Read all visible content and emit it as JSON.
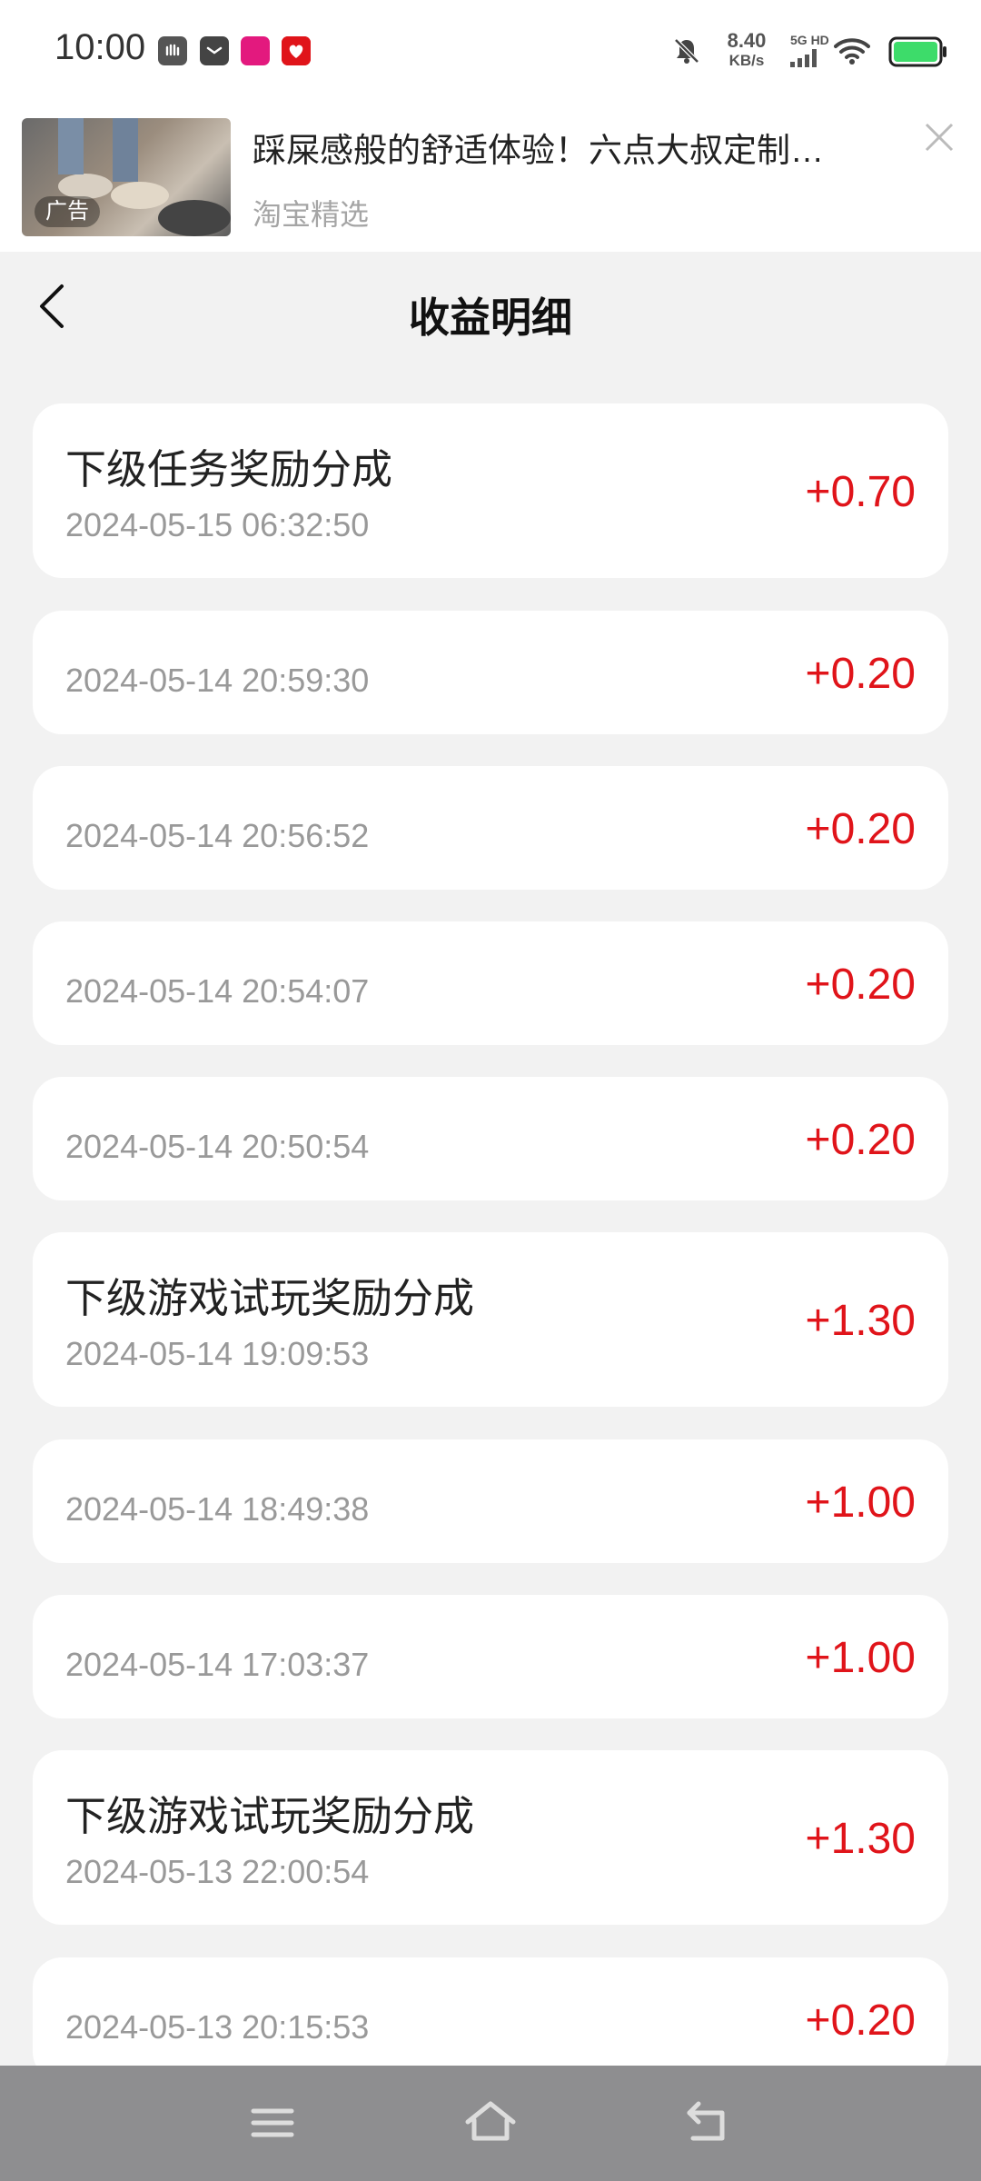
{
  "status_bar": {
    "time": "10:00",
    "net_speed": "8.40",
    "net_speed_unit": "KB/s",
    "net_type": "5G HD",
    "battery_color": "#3ddc6a"
  },
  "ad": {
    "tag": "广告",
    "title": "踩屎感般的舒适体验！六点大叔定制…",
    "source": "淘宝精选"
  },
  "header": {
    "title": "收益明细"
  },
  "records": [
    {
      "title": "下级任务奖励分成",
      "time": "2024-05-15 06:32:50",
      "amount": "+0.70"
    },
    {
      "title": "",
      "time": "2024-05-14 20:59:30",
      "amount": "+0.20"
    },
    {
      "title": "",
      "time": "2024-05-14 20:56:52",
      "amount": "+0.20"
    },
    {
      "title": "",
      "time": "2024-05-14 20:54:07",
      "amount": "+0.20"
    },
    {
      "title": "",
      "time": "2024-05-14 20:50:54",
      "amount": "+0.20"
    },
    {
      "title": "下级游戏试玩奖励分成",
      "time": "2024-05-14 19:09:53",
      "amount": "+1.30"
    },
    {
      "title": "",
      "time": "2024-05-14 18:49:38",
      "amount": "+1.00"
    },
    {
      "title": "",
      "time": "2024-05-14 17:03:37",
      "amount": "+1.00"
    },
    {
      "title": "下级游戏试玩奖励分成",
      "time": "2024-05-13 22:00:54",
      "amount": "+1.30"
    },
    {
      "title": "",
      "time": "2024-05-13 20:15:53",
      "amount": "+0.20"
    }
  ],
  "colors": {
    "amount": "#e0141a",
    "background": "#f2f2f2",
    "nav_bar": "#8e8e90"
  }
}
